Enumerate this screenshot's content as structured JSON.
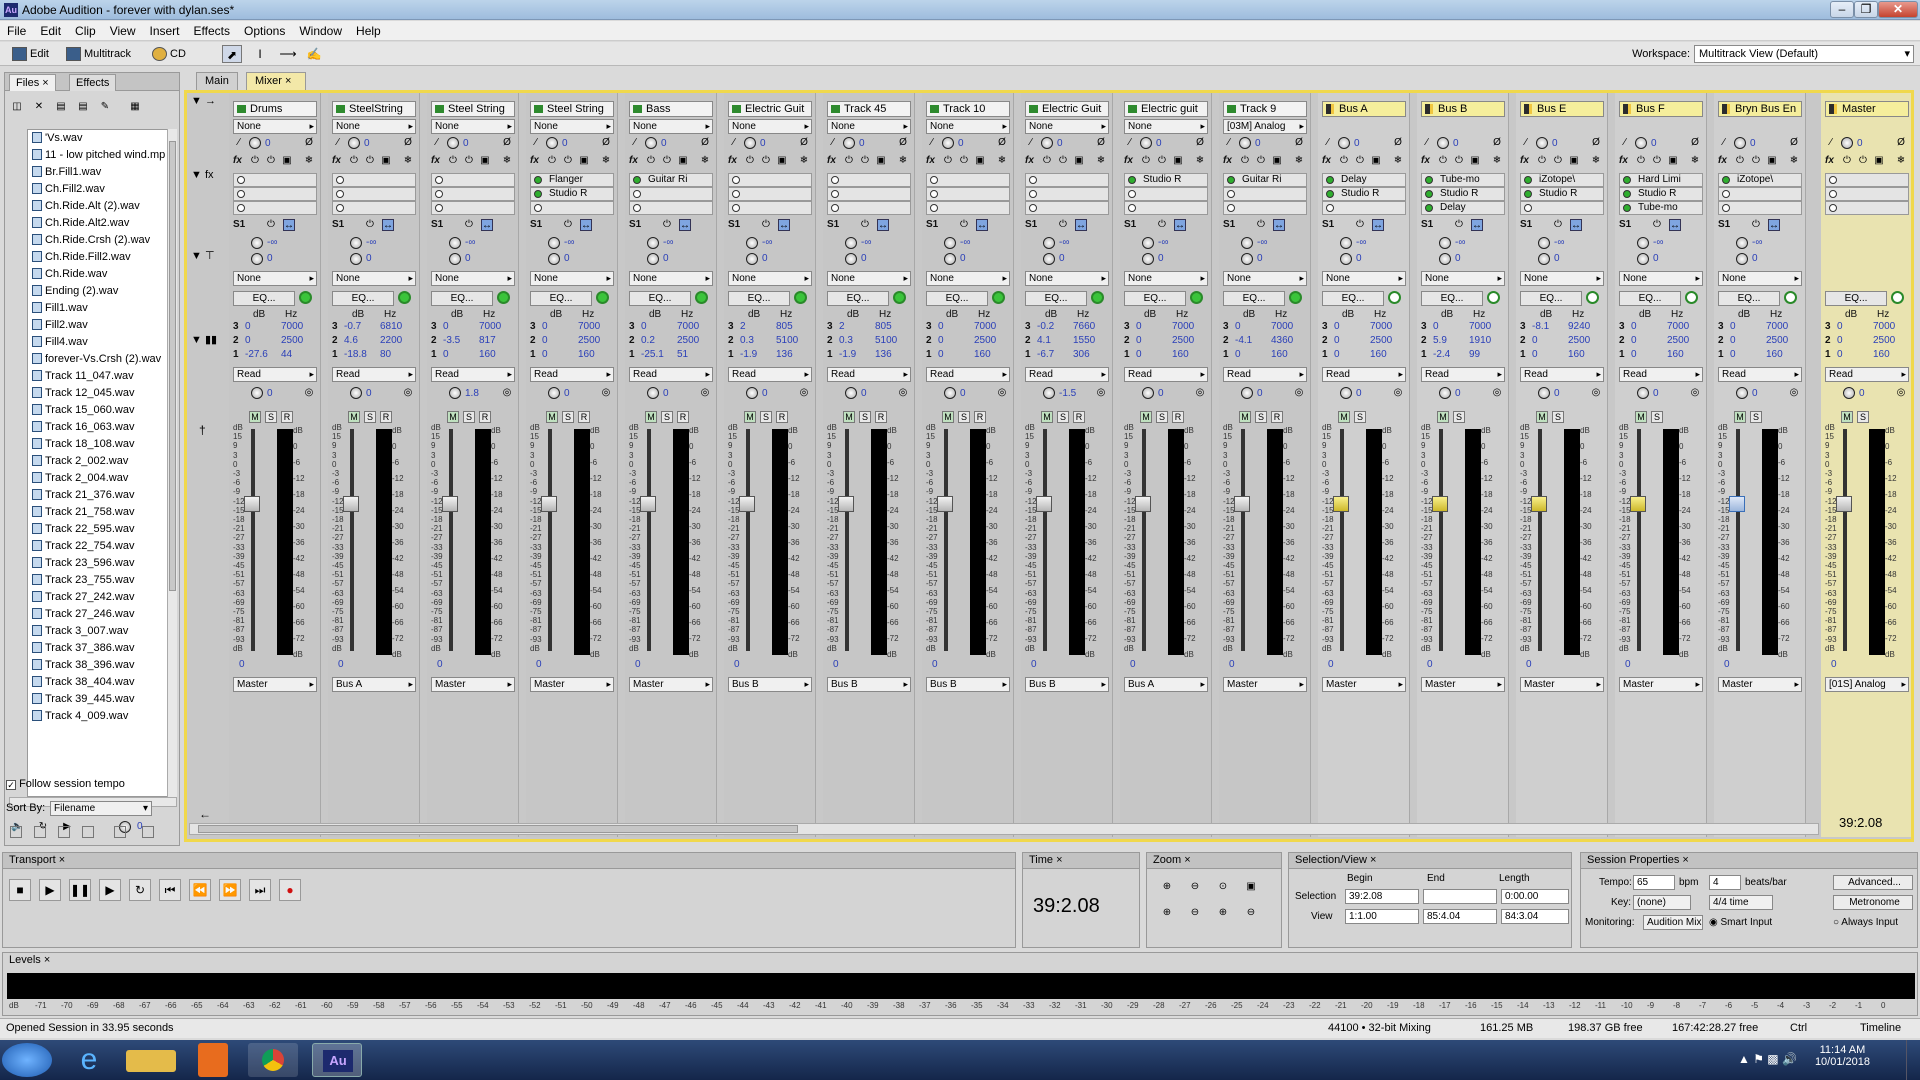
{
  "window": {
    "title": "Adobe Audition - forever with dylan.ses*",
    "app_icon": "Au"
  },
  "menu": [
    "File",
    "Edit",
    "Clip",
    "View",
    "Insert",
    "Effects",
    "Options",
    "Window",
    "Help"
  ],
  "toolbar": {
    "edit": "Edit",
    "multitrack": "Multitrack",
    "cd": "CD",
    "workspace_label": "Workspace:",
    "workspace_value": "Multitrack View (Default)"
  },
  "left_panel": {
    "tabs": [
      "Files",
      "Effects"
    ],
    "files": [
      "'Vs.wav",
      "11 - low pitched wind.mp",
      "Br.Fill1.wav",
      "Ch.Fill2.wav",
      "Ch.Ride.Alt (2).wav",
      "Ch.Ride.Alt2.wav",
      "Ch.Ride.Crsh (2).wav",
      "Ch.Ride.Fill2.wav",
      "Ch.Ride.wav",
      "Ending (2).wav",
      "Fill1.wav",
      "Fill2.wav",
      "Fill4.wav",
      "forever-Vs.Crsh (2).wav",
      "Track 11_047.wav",
      "Track 12_045.wav",
      "Track 15_060.wav",
      "Track 16_063.wav",
      "Track 18_108.wav",
      "Track 2_002.wav",
      "Track 2_004.wav",
      "Track 21_376.wav",
      "Track 21_758.wav",
      "Track 22_595.wav",
      "Track 22_754.wav",
      "Track 23_596.wav",
      "Track 23_755.wav",
      "Track 27_242.wav",
      "Track 27_246.wav",
      "Track 3_007.wav",
      "Track 37_386.wav",
      "Track 38_396.wav",
      "Track 38_404.wav",
      "Track 39_445.wav",
      "Track 4_009.wav"
    ],
    "follow_session_tempo": "Follow session tempo",
    "sort_by_label": "Sort By:",
    "sort_by_value": "Filename"
  },
  "mixer_tabs": [
    "Main",
    "Mixer"
  ],
  "channels": [
    {
      "name": "Drums",
      "type": "track",
      "input": "None",
      "fx": [
        "",
        "",
        ""
      ],
      "eq": [
        [
          "3",
          "0",
          "7000"
        ],
        [
          "2",
          "0",
          "2500"
        ],
        [
          "1",
          "-27.6",
          "44"
        ]
      ],
      "auto": "Read",
      "out": "Master",
      "pan": "0",
      "fader_pos": 0.3
    },
    {
      "name": "SteelString",
      "type": "track",
      "input": "None",
      "fx": [
        "",
        "",
        ""
      ],
      "eq": [
        [
          "3",
          "-0.7",
          "6810"
        ],
        [
          "2",
          "4.6",
          "2200"
        ],
        [
          "1",
          "-18.8",
          "80"
        ]
      ],
      "auto": "Read",
      "out": "Bus A",
      "pan": "0",
      "fader_pos": 0.3
    },
    {
      "name": "Steel String",
      "type": "track",
      "input": "None",
      "fx": [
        "",
        "",
        ""
      ],
      "eq": [
        [
          "3",
          "0",
          "7000"
        ],
        [
          "2",
          "-3.5",
          "817"
        ],
        [
          "1",
          "0",
          "160"
        ]
      ],
      "auto": "Read",
      "out": "Master",
      "pan": "1.8",
      "fader_pos": 0.3
    },
    {
      "name": "Steel String",
      "type": "track",
      "input": "None",
      "fx": [
        "Flanger",
        "Studio R",
        ""
      ],
      "eq": [
        [
          "3",
          "0",
          "7000"
        ],
        [
          "2",
          "0",
          "2500"
        ],
        [
          "1",
          "0",
          "160"
        ]
      ],
      "auto": "Read",
      "out": "Master",
      "pan": "0",
      "fader_pos": 0.3
    },
    {
      "name": "Bass",
      "type": "track",
      "input": "None",
      "fx": [
        "Guitar Ri",
        "",
        ""
      ],
      "eq": [
        [
          "3",
          "0",
          "7000"
        ],
        [
          "2",
          "0.2",
          "2500"
        ],
        [
          "1",
          "-25.1",
          "51"
        ]
      ],
      "auto": "Read",
      "out": "Master",
      "pan": "0",
      "fader_pos": 0.3
    },
    {
      "name": "Electric Guit",
      "type": "track",
      "input": "None",
      "fx": [
        "",
        "",
        ""
      ],
      "eq": [
        [
          "3",
          "2",
          "805"
        ],
        [
          "2",
          "0.3",
          "5100"
        ],
        [
          "1",
          "-1.9",
          "136"
        ]
      ],
      "auto": "Read",
      "out": "Bus B",
      "pan": "0",
      "fader_pos": 0.3
    },
    {
      "name": "Track 45",
      "type": "track",
      "input": "None",
      "fx": [
        "",
        "",
        ""
      ],
      "eq": [
        [
          "3",
          "2",
          "805"
        ],
        [
          "2",
          "0.3",
          "5100"
        ],
        [
          "1",
          "-1.9",
          "136"
        ]
      ],
      "auto": "Read",
      "out": "Bus B",
      "pan": "0",
      "fader_pos": 0.3
    },
    {
      "name": "Track 10",
      "type": "track",
      "input": "None",
      "fx": [
        "",
        "",
        ""
      ],
      "eq": [
        [
          "3",
          "0",
          "7000"
        ],
        [
          "2",
          "0",
          "2500"
        ],
        [
          "1",
          "0",
          "160"
        ]
      ],
      "auto": "Read",
      "out": "Bus B",
      "pan": "0",
      "fader_pos": 0.3
    },
    {
      "name": "Electric Guit",
      "type": "track",
      "input": "None",
      "fx": [
        "",
        "",
        ""
      ],
      "eq": [
        [
          "3",
          "-0.2",
          "7660"
        ],
        [
          "2",
          "4.1",
          "1550"
        ],
        [
          "1",
          "-6.7",
          "306"
        ]
      ],
      "auto": "Read",
      "out": "Bus B",
      "pan": "-1.5",
      "fader_pos": 0.3
    },
    {
      "name": "Electric guit",
      "type": "track",
      "input": "None",
      "fx": [
        "Studio R",
        "",
        ""
      ],
      "eq": [
        [
          "3",
          "0",
          "7000"
        ],
        [
          "2",
          "0",
          "2500"
        ],
        [
          "1",
          "0",
          "160"
        ]
      ],
      "auto": "Read",
      "out": "Bus A",
      "pan": "0",
      "fader_pos": 0.3
    },
    {
      "name": "Track 9",
      "type": "track",
      "input": "[03M] Analog",
      "fx": [
        "Guitar Ri",
        "",
        ""
      ],
      "eq": [
        [
          "3",
          "0",
          "7000"
        ],
        [
          "2",
          "-4.1",
          "4360"
        ],
        [
          "1",
          "0",
          "160"
        ]
      ],
      "auto": "Read",
      "out": "Master",
      "pan": "0",
      "fader_pos": 0.3
    },
    {
      "name": "Bus A",
      "type": "bus",
      "input": "",
      "fx": [
        "Delay",
        "Studio R",
        ""
      ],
      "eq": [
        [
          "3",
          "0",
          "7000"
        ],
        [
          "2",
          "0",
          "2500"
        ],
        [
          "1",
          "0",
          "160"
        ]
      ],
      "auto": "Read",
      "out": "Master",
      "pan": "0",
      "fader_pos": 0.3
    },
    {
      "name": "Bus B",
      "type": "bus",
      "input": "",
      "fx": [
        "Tube-mo",
        "Studio R",
        "Delay"
      ],
      "eq": [
        [
          "3",
          "0",
          "7000"
        ],
        [
          "2",
          "5.9",
          "1910"
        ],
        [
          "1",
          "-2.4",
          "99"
        ]
      ],
      "auto": "Read",
      "out": "Master",
      "pan": "0",
      "fader_pos": 0.3
    },
    {
      "name": "Bus E",
      "type": "bus",
      "input": "",
      "fx": [
        "iZotope\\",
        "Studio R",
        ""
      ],
      "eq": [
        [
          "3",
          "-8.1",
          "9240"
        ],
        [
          "2",
          "0",
          "2500"
        ],
        [
          "1",
          "0",
          "160"
        ]
      ],
      "auto": "Read",
      "out": "Master",
      "pan": "0",
      "fader_pos": 0.3
    },
    {
      "name": "Bus F",
      "type": "bus",
      "input": "",
      "fx": [
        "Hard Limi",
        "Studio R",
        "Tube-mo"
      ],
      "eq": [
        [
          "3",
          "0",
          "7000"
        ],
        [
          "2",
          "0",
          "2500"
        ],
        [
          "1",
          "0",
          "160"
        ]
      ],
      "auto": "Read",
      "out": "Master",
      "pan": "0",
      "fader_pos": 0.3
    },
    {
      "name": "Bryn Bus En",
      "type": "bus",
      "input": "",
      "fx": [
        "iZotope\\",
        "",
        ""
      ],
      "eq": [
        [
          "3",
          "0",
          "7000"
        ],
        [
          "2",
          "0",
          "2500"
        ],
        [
          "1",
          "0",
          "160"
        ]
      ],
      "auto": "Read",
      "out": "Master",
      "pan": "0",
      "fader_pos": 0.3
    }
  ],
  "master": {
    "name": "Master",
    "out": "[01S] Analog",
    "pan": "0",
    "eq": [
      [
        "3",
        "0",
        "7000"
      ],
      [
        "2",
        "0",
        "2500"
      ],
      [
        "1",
        "0",
        "160"
      ]
    ],
    "auto": "Read",
    "time": "39:2.08"
  },
  "strip_labels": {
    "send": "S1",
    "eq": "EQ...",
    "db": "dB",
    "hz": "Hz",
    "none": "None",
    "fader_val": "0",
    "m": "M",
    "s": "S",
    "r": "R",
    "pan_zero": "0"
  },
  "fader_scale": [
    "dB",
    "15",
    "9",
    "3",
    "0",
    "-3",
    "-6",
    "-9",
    "-12",
    "-15",
    "-18",
    "-21",
    "-27",
    "-33",
    "-39",
    "-45",
    "-51",
    "-57",
    "-63",
    "-69",
    "-75",
    "-81",
    "-87",
    "-93",
    "dB"
  ],
  "meter_scale": [
    "dB",
    "0",
    "-6",
    "-12",
    "-18",
    "-24",
    "-30",
    "-36",
    "-42",
    "-48",
    "-54",
    "-60",
    "-66",
    "-72",
    "dB"
  ],
  "transport": {
    "title": "Transport"
  },
  "time": {
    "title": "Time",
    "value": "39:2.08"
  },
  "zoom": {
    "title": "Zoom"
  },
  "selection_view": {
    "title": "Selection/View",
    "begin": "Begin",
    "end": "End",
    "length": "Length",
    "selection_label": "Selection",
    "view_label": "View",
    "sel_begin": "39:2.08",
    "sel_end": "",
    "sel_length": "0:00.00",
    "view_begin": "1:1.00",
    "view_end": "85:4.04",
    "view_length": "84:3.04"
  },
  "session": {
    "title": "Session Properties",
    "tempo_label": "Tempo:",
    "tempo": "65",
    "bpm": "bpm",
    "beats": "4",
    "beats_label": "beats/bar",
    "advanced": "Advanced...",
    "key_label": "Key:",
    "key": "(none)",
    "time_sig": "4/4 time",
    "metronome": "Metronome",
    "monitoring_label": "Monitoring:",
    "monitoring": "Audition Mix",
    "smart_input": "Smart Input",
    "always_input": "Always Input"
  },
  "levels": {
    "title": "Levels",
    "scale": [
      "dB",
      "-71",
      "-70",
      "-69",
      "-68",
      "-67",
      "-66",
      "-65",
      "-64",
      "-63",
      "-62",
      "-61",
      "-60",
      "-59",
      "-58",
      "-57",
      "-56",
      "-55",
      "-54",
      "-53",
      "-52",
      "-51",
      "-50",
      "-49",
      "-48",
      "-47",
      "-46",
      "-45",
      "-44",
      "-43",
      "-42",
      "-41",
      "-40",
      "-39",
      "-38",
      "-37",
      "-36",
      "-35",
      "-34",
      "-33",
      "-32",
      "-31",
      "-30",
      "-29",
      "-28",
      "-27",
      "-26",
      "-25",
      "-24",
      "-23",
      "-22",
      "-21",
      "-20",
      "-19",
      "-18",
      "-17",
      "-16",
      "-15",
      "-14",
      "-13",
      "-12",
      "-11",
      "-10",
      "-9",
      "-8",
      "-7",
      "-6",
      "-5",
      "-4",
      "-3",
      "-2",
      "-1",
      "0"
    ]
  },
  "status": {
    "message": "Opened Session in 33.95 seconds",
    "format": "44100 • 32-bit Mixing",
    "ram": "161.25 MB",
    "disk": "198.37 GB free",
    "free_time": "167:42:28.27 free",
    "ctrl": "Ctrl",
    "view": "Timeline"
  },
  "taskbar": {
    "time": "11:14 AM",
    "date": "10/01/2018"
  }
}
